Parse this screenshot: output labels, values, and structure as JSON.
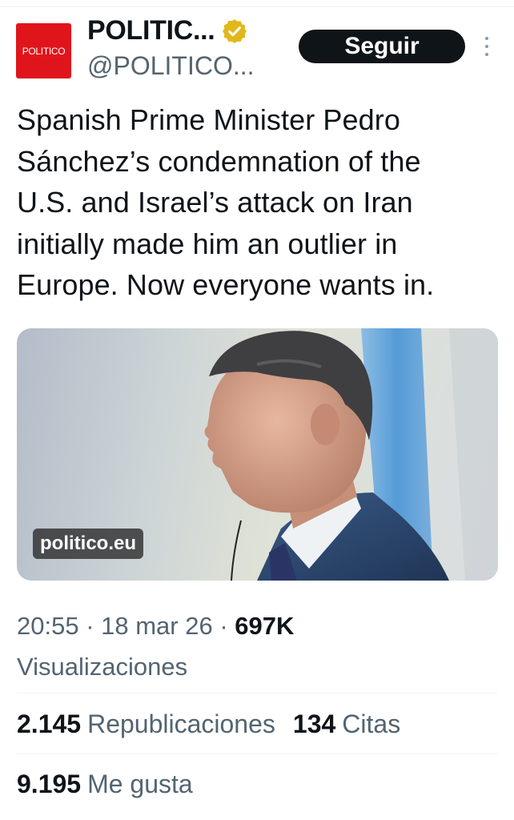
{
  "account": {
    "avatar_text": "POLITICO",
    "name": "POLITIC...",
    "handle": "@POLITICO...",
    "verified_icon": "verified-badge-gold"
  },
  "follow_label": "Seguir",
  "tweet": {
    "lines": [
      "Spanish Prime Minister Pedro",
      "Sánchez’s condemnation of the",
      "U.S. and Israel’s attack on Iran",
      "initially made him an outlier in",
      "Europe. Now everyone wants in."
    ]
  },
  "card": {
    "domain": "politico.eu"
  },
  "meta": {
    "time": "20:55",
    "date": "18 mar 26",
    "views_count": "697K",
    "views_label": "Visualizaciones"
  },
  "stats": {
    "reposts_count": "2.145",
    "reposts_label": "Republicaciones",
    "quotes_count": "134",
    "quotes_label": "Citas",
    "likes_count": "9.195",
    "likes_label": "Me gusta"
  },
  "colors": {
    "avatar_bg": "#e0151c",
    "button_bg": "#0f1419",
    "secondary_text": "#536471",
    "verified_gold": "#e2b719"
  }
}
